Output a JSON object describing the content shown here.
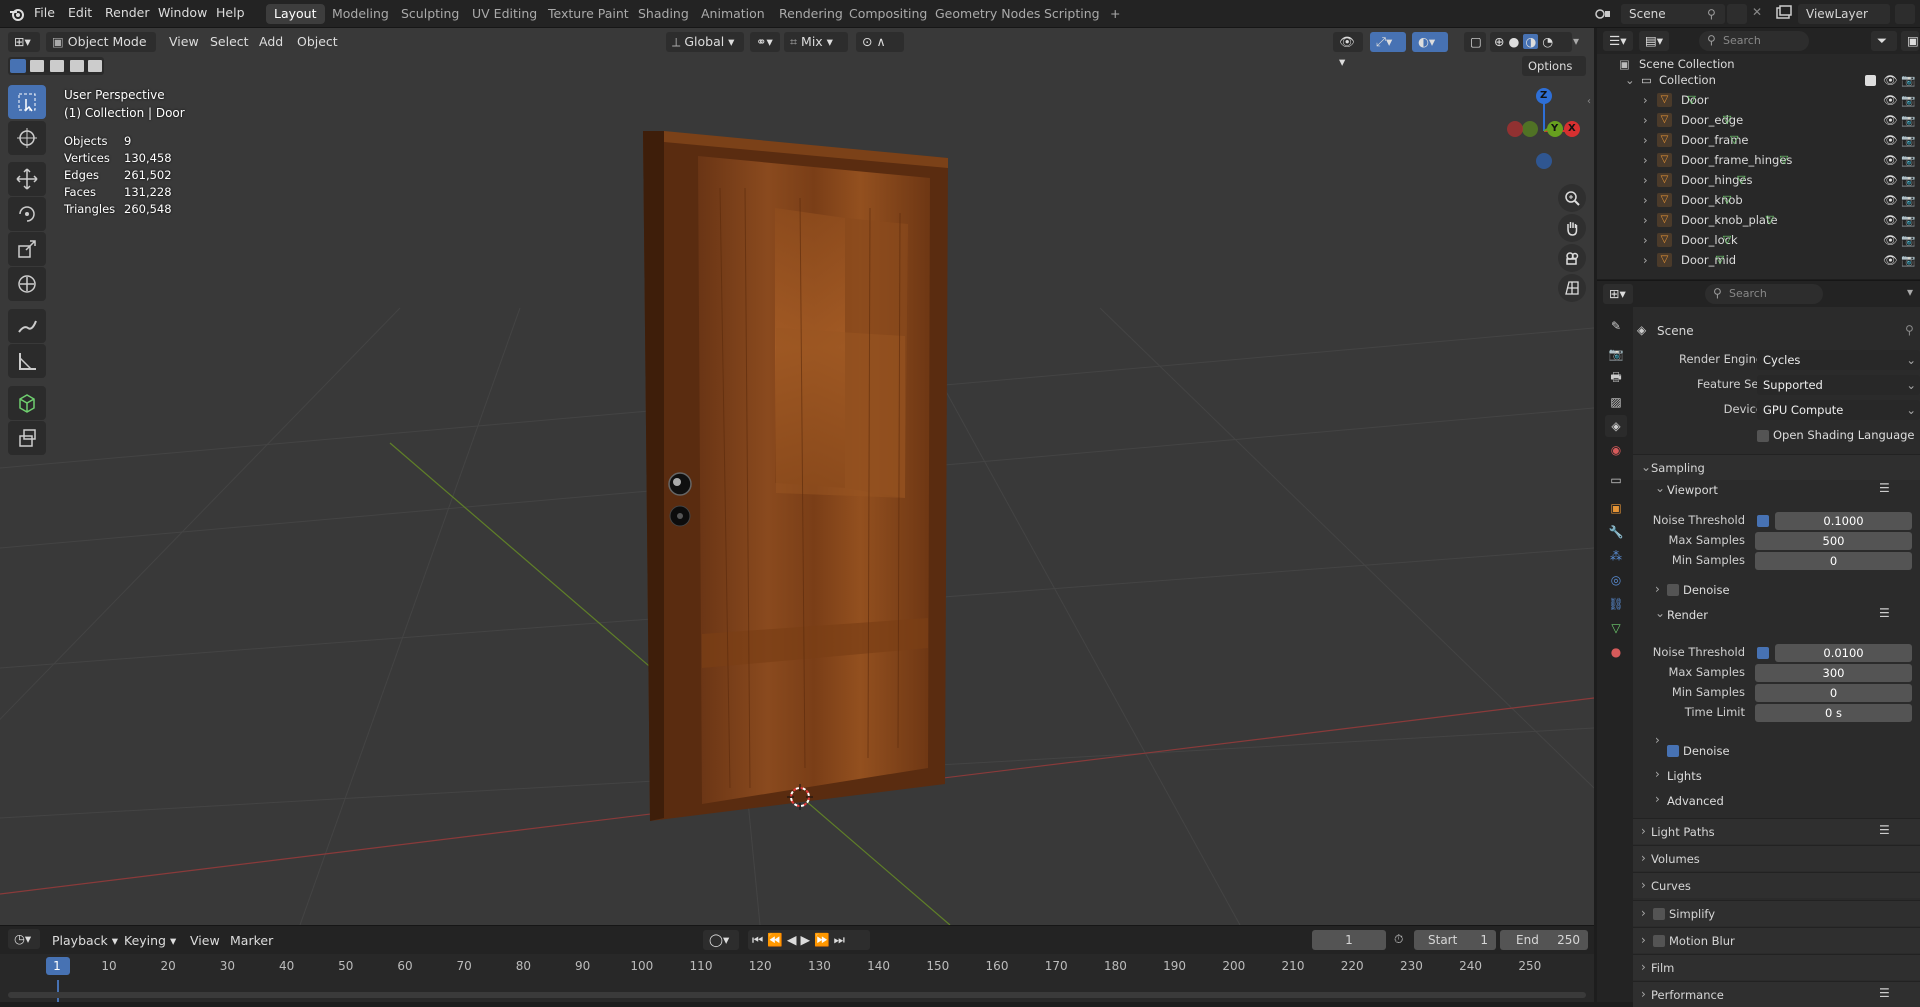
{
  "menus": [
    "File",
    "Edit",
    "Render",
    "Window",
    "Help"
  ],
  "workspaces": [
    "Layout",
    "Modeling",
    "Sculpting",
    "UV Editing",
    "Texture Paint",
    "Shading",
    "Animation",
    "Rendering",
    "Compositing",
    "Geometry Nodes",
    "Scripting"
  ],
  "add_workspace": "+",
  "scene_name": "Scene",
  "view_layer": "ViewLayer",
  "viewport": {
    "mode": "Object Mode",
    "menus": [
      "View",
      "Select",
      "Add",
      "Object"
    ],
    "orientation": "Global",
    "snap_mode": "Mix",
    "options": "Options",
    "overlay_title": "User Perspective",
    "overlay_sub": "(1) Collection | Door",
    "stats": [
      {
        "label": "Objects",
        "value": "9"
      },
      {
        "label": "Vertices",
        "value": "130,458"
      },
      {
        "label": "Edges",
        "value": "261,502"
      },
      {
        "label": "Faces",
        "value": "131,228"
      },
      {
        "label": "Triangles",
        "value": "260,548"
      }
    ],
    "gizmo": {
      "z": "Z",
      "y": "Y",
      "x": "X"
    }
  },
  "timeline": {
    "menus": [
      "Playback",
      "Keying",
      "View",
      "Marker"
    ],
    "current_frame": "1",
    "start_label": "Start",
    "start": "1",
    "end_label": "End",
    "end": "250",
    "ticks": [
      "1",
      "10",
      "20",
      "30",
      "40",
      "50",
      "60",
      "70",
      "80",
      "90",
      "100",
      "110",
      "120",
      "130",
      "140",
      "150",
      "160",
      "170",
      "180",
      "190",
      "200",
      "210",
      "220",
      "230",
      "240",
      "250"
    ]
  },
  "outliner": {
    "search_placeholder": "Search",
    "scene_collection": "Scene Collection",
    "collection": "Collection",
    "items": [
      "Door",
      "Door_edge",
      "Door_frame",
      "Door_frame_hinges",
      "Door_hinges",
      "Door_knob",
      "Door_knob_plate",
      "Door_lock",
      "Door_mid"
    ]
  },
  "properties": {
    "search_placeholder": "Search",
    "context": "Scene",
    "render_engine_label": "Render Engine",
    "render_engine": "Cycles",
    "feature_set_label": "Feature Set",
    "feature_set": "Supported",
    "device_label": "Device",
    "device": "GPU Compute",
    "osl_label": "Open Shading Language",
    "sampling": "Sampling",
    "viewport_sub": "Viewport",
    "render_sub": "Render",
    "noise_threshold_label": "Noise Threshold",
    "max_samples_label": "Max Samples",
    "min_samples_label": "Min Samples",
    "time_limit_label": "Time Limit",
    "vp_noise": "0.1000",
    "vp_max": "500",
    "vp_min": "0",
    "r_noise": "0.0100",
    "r_max": "300",
    "r_min": "0",
    "r_time": "0 s",
    "denoise": "Denoise",
    "lights": "Lights",
    "advanced": "Advanced",
    "sections": [
      "Light Paths",
      "Volumes",
      "Curves",
      "Simplify",
      "Motion Blur",
      "Film",
      "Performance"
    ]
  }
}
